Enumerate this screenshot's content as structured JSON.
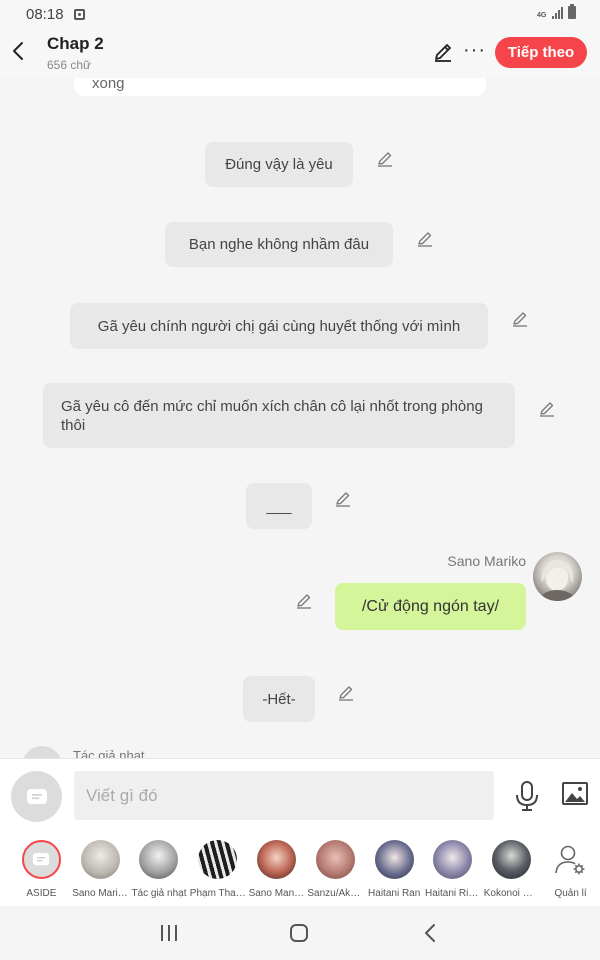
{
  "status": {
    "time": "08:18",
    "network": "4G"
  },
  "header": {
    "title": "Chap 2",
    "subtitle": "656 chữ",
    "next_label": "Tiếp theo"
  },
  "messages": [
    {
      "text": "xong"
    },
    {
      "text": "Đúng vậy là yêu"
    },
    {
      "text": "Bạn nghe không nhầm đâu"
    },
    {
      "text": "Gã yêu chính người chị gái cùng huyết thống với mình"
    },
    {
      "text": "Gã yêu cô đến mức chỉ muốn xích chân cô lại nhốt trong phòng thôi"
    },
    {
      "text": "___"
    },
    {
      "sender": "Sano Mariko",
      "text": "/Cử động ngón tay/"
    },
    {
      "text": "-Hết-"
    }
  ],
  "partial_sender": "Tác giả nhạt",
  "input": {
    "placeholder": "Viết gì đó"
  },
  "characters": [
    {
      "label": "ASIDE",
      "color": "#dcdcdc"
    },
    {
      "label": "Sano Mariko",
      "color": "#b9b4ae"
    },
    {
      "label": "Tác giả nhạt",
      "color": "#9a9a9a"
    },
    {
      "label": "Phạm Thanh",
      "color": "#3a3a3a"
    },
    {
      "label": "Sano Manjiro",
      "color": "#8c5a4e"
    },
    {
      "label": "Sanzu/Akashi",
      "color": "#b57a72"
    },
    {
      "label": "Haitani Ran",
      "color": "#4b4e6e"
    },
    {
      "label": "Haitani Rindou",
      "color": "#8a86a8"
    },
    {
      "label": "Kokonoi Hajime",
      "color": "#3b3f44"
    },
    {
      "label": "Quản lí"
    }
  ]
}
